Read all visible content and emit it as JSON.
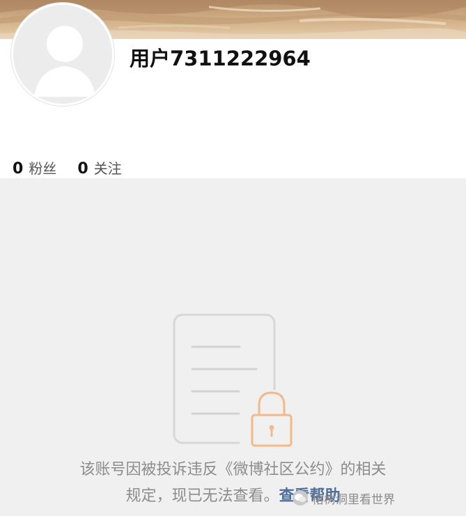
{
  "profile": {
    "username": "用户7311222964",
    "followers_count": "0",
    "followers_label": "粉丝",
    "following_count": "0",
    "following_label": "关注"
  },
  "notice": {
    "line1": "该账号因被投诉违反《微博社区公约》的相关",
    "line2_prefix": "规定，现已无法查看。",
    "help_link": "查看帮助"
  },
  "watermark": {
    "text": "榕树洞里看世界",
    "icon": "wechat-icon"
  },
  "colors": {
    "content_bg": "#f0f0f0",
    "lock_accent": "#f2b98a",
    "link": "#4d6d9a",
    "notice_text": "#8c8c8c"
  },
  "icons": {
    "avatar": "default-avatar-icon",
    "illustration": "locked-document-icon"
  }
}
